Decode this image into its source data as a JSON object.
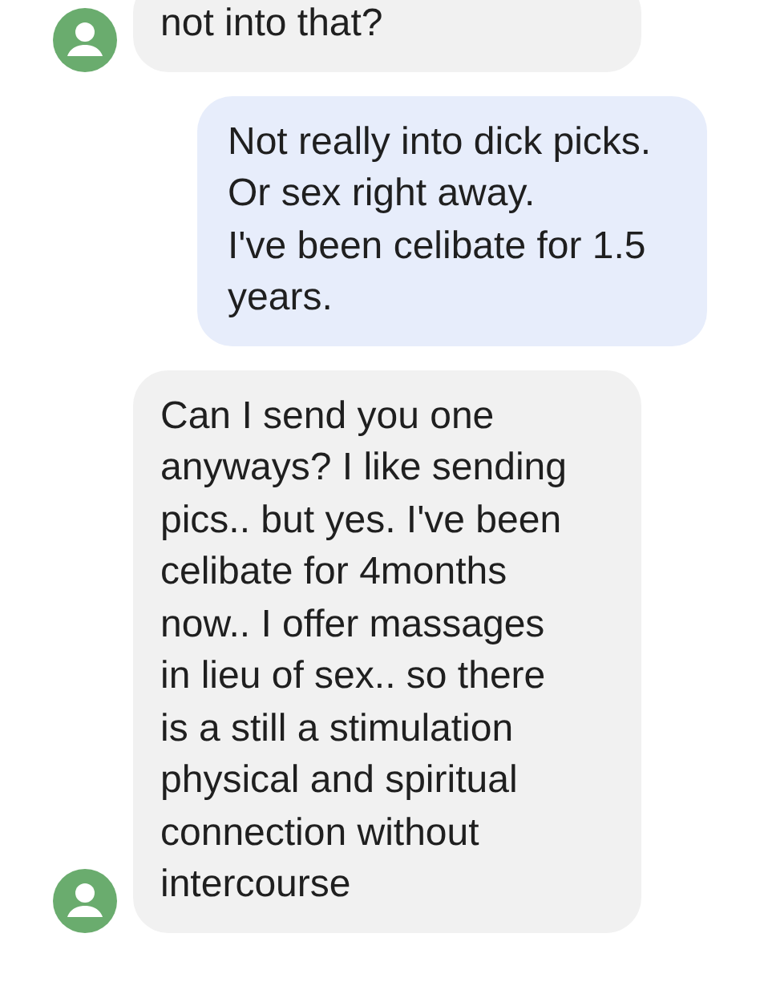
{
  "messages": [
    {
      "kind": "received",
      "text": "not into that?"
    },
    {
      "kind": "sent",
      "text": "Not really into dick picks.\nOr sex right away.\nI've been celibate for 1.5 years."
    },
    {
      "kind": "received",
      "text": "Can I send you one anyways? I like sending pics.. but yes. I've been celibate for 4months now.. I offer massages in lieu of sex.. so there is a still a stimulation physical and spiritual connection without intercourse"
    }
  ]
}
